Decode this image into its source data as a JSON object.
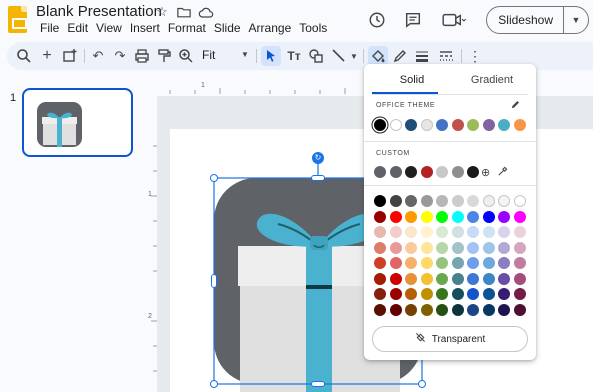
{
  "app": {
    "title": "Blank Presentation",
    "menus": [
      "File",
      "Edit",
      "View",
      "Insert",
      "Format",
      "Slide",
      "Arrange",
      "Tools"
    ],
    "slideshow_label": "Slideshow"
  },
  "toolbar": {
    "zoom": "Fit",
    "icons": [
      "search-icon",
      "add-icon",
      "new-slide-icon",
      "undo-icon",
      "redo-icon",
      "print-icon",
      "paint-format-icon",
      "zoom-icon",
      "select-icon",
      "text-box-icon",
      "shape-icon",
      "line-icon",
      "fill-color-icon",
      "border-color-icon",
      "border-weight-icon",
      "border-dash-icon",
      "more-icon"
    ]
  },
  "filmstrip": {
    "slide_number": "1"
  },
  "panel": {
    "tabs": [
      "Solid",
      "Gradient"
    ],
    "office_theme_label": "OFFICE THEME",
    "custom_label": "CUSTOM",
    "transparent_label": "Transparent",
    "theme_colors": [
      "#000000",
      "#ffffff",
      "#1f4e79",
      "#e7e6e6",
      "#4472c4",
      "#c0504d",
      "#9bbb59",
      "#8064a2",
      "#4bacc6",
      "#f79646"
    ],
    "custom_colors": [
      "#5f6368",
      "#5f6368",
      "#1f1f1f",
      "#b22222",
      "#c8c8c8",
      "#8e8e8e",
      "#1a1a1a"
    ],
    "grid_colors": [
      [
        "#000000",
        "#434343",
        "#666666",
        "#999999",
        "#b7b7b7",
        "#cccccc",
        "#d9d9d9",
        "#efefef",
        "#f3f3f3",
        "#ffffff"
      ],
      [
        "#980000",
        "#ff0000",
        "#ff9900",
        "#ffff00",
        "#00ff00",
        "#00ffff",
        "#4a86e8",
        "#0000ff",
        "#9900ff",
        "#ff00ff"
      ],
      [
        "#e6b8af",
        "#f4cccc",
        "#fce5cd",
        "#fff2cc",
        "#d9ead3",
        "#d0e0e3",
        "#c9daf8",
        "#cfe2f3",
        "#d9d2e9",
        "#ead1dc"
      ],
      [
        "#dd7e6b",
        "#ea9999",
        "#f9cb9c",
        "#ffe599",
        "#b6d7a8",
        "#a2c4c9",
        "#a4c2f4",
        "#9fc5e8",
        "#b4a7d6",
        "#d5a6bd"
      ],
      [
        "#cc4125",
        "#e06666",
        "#f6b26b",
        "#ffd966",
        "#93c47d",
        "#76a5af",
        "#6d9eeb",
        "#6fa8dc",
        "#8e7cc3",
        "#c27ba0"
      ],
      [
        "#a61c00",
        "#cc0000",
        "#e69138",
        "#f1c232",
        "#6aa84f",
        "#45818e",
        "#3c78d8",
        "#3d85c6",
        "#674ea7",
        "#a64d79"
      ],
      [
        "#85200c",
        "#990000",
        "#b45f06",
        "#bf9000",
        "#38761d",
        "#134f5c",
        "#1155cc",
        "#0b5394",
        "#351c75",
        "#741b47"
      ],
      [
        "#5b0f00",
        "#660000",
        "#783f04",
        "#7f6000",
        "#274e13",
        "#0c343d",
        "#1c4587",
        "#073763",
        "#20124d",
        "#4c1130"
      ]
    ]
  },
  "ruler": {
    "h_marks": [
      "1"
    ],
    "v_marks": [
      "1",
      "2"
    ]
  },
  "colors": {
    "accent": "#0b57d0",
    "ribbon": "#4ab2cf",
    "box_bg": "#5f6368",
    "box": "#e0e0e0"
  }
}
